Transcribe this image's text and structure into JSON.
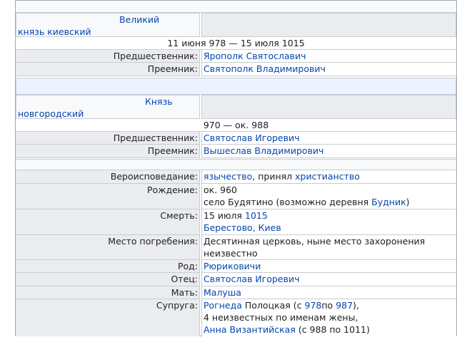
{
  "grand_prince": {
    "title_line1": "Великий",
    "title_line2": "князь киевский",
    "dates": "11 июня 978 — 15 июля 1015",
    "predecessor_label": "Предшественник:",
    "predecessor": "Ярополк Святославич",
    "successor_label": "Преемник:",
    "successor": "Святополк Владимирович"
  },
  "novgorod_prince": {
    "title_line1": "Князь",
    "title_line2": "новгородский",
    "dates": "970 — ок. 988",
    "predecessor_label": "Предшественник:",
    "predecessor": "Святослав Игоревич",
    "successor_label": "Преемник:",
    "successor": "Вышеслав Владимирович"
  },
  "details": {
    "religion_label": "Вероисповедание:",
    "religion_link1": "язычество",
    "religion_mid": ", принял ",
    "religion_link2": "христианство",
    "birth_label": "Рождение:",
    "birth_line1": "ок. 960",
    "birth_line2_prefix": "село Будятино (возможно деревня ",
    "birth_line2_link": "Будник",
    "birth_line2_suffix": ")",
    "death_label": "Смерть:",
    "death_line1_prefix": "15 июля ",
    "death_line1_link": "1015",
    "death_line2": "Берестово, Киев",
    "burial_label": "Место погребения:",
    "burial_line1": "Десятинная церковь, ныне место захоронения",
    "burial_line2": "неизвестно",
    "dynasty_label": "Род:",
    "dynasty": "Рюриковичи",
    "father_label": "Отец:",
    "father": "Святослав Игоревич",
    "mother_label": "Мать:",
    "mother": "Малуша",
    "spouse_label": "Супруга:",
    "spouse_link1": "Рогнеда",
    "spouse_l1_mid1": " Полоцкая (с ",
    "spouse_link2": "978",
    "spouse_l1_mid2": "по ",
    "spouse_link3": "987",
    "spouse_l1_end": "),",
    "spouse_line2": "4 неизвестных по именам жены,",
    "spouse_link4": "Анна Византийская",
    "spouse_l3_end": " (с 988 по 1011)"
  }
}
